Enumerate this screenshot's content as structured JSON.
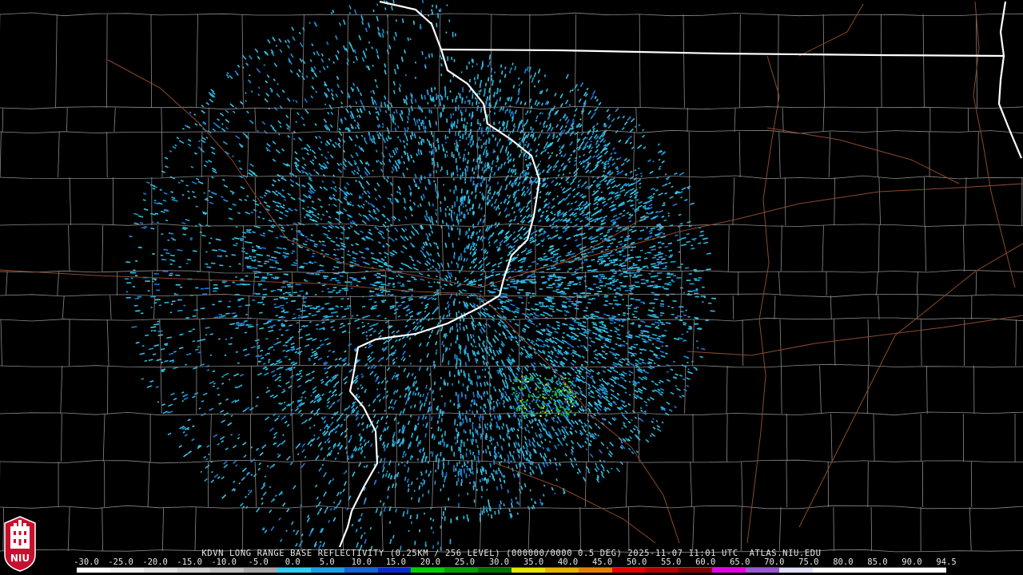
{
  "product_title": "KDVN LONG RANGE BASE REFLECTIVITY (0.25KM / 256 LEVEL) (000000/0000 0.5 DEG) 2025-11-07 11:01 UTC  ATLAS.NIU.EDU",
  "logo": {
    "text": "NIU",
    "color": "#c8102e"
  },
  "colors": {
    "background": "#000000",
    "county_lines": "#8a8a8a",
    "state_lines": "#ffffff",
    "highways": "#8b4a2b",
    "echo_primary": "#2fb8e0",
    "echo_secondary": "#1e78d8",
    "echo_green": "#22c040",
    "echo_yellow": "#e6e600"
  },
  "scale": {
    "labels": [
      "-30.0",
      "-25.0",
      "-20.0",
      "-15.0",
      "-10.0",
      "-5.0",
      "0.0",
      "5.0",
      "10.0",
      "15.0",
      "20.0",
      "25.0",
      "30.0",
      "35.0",
      "40.0",
      "45.0",
      "50.0",
      "55.0",
      "60.0",
      "65.0",
      "70.0",
      "75.0",
      "80.0",
      "85.0",
      "90.0",
      "94.5"
    ],
    "colors": [
      "#ffffff",
      "#f0f0f0",
      "#e0e0e0",
      "#d0d0d0",
      "#c0c0c0",
      "#a8a8a8",
      "#2fd0f0",
      "#1aa0e8",
      "#1464d8",
      "#0a2ad0",
      "#00d000",
      "#00a000",
      "#007000",
      "#e6e600",
      "#e6b400",
      "#e68000",
      "#e60000",
      "#b40000",
      "#800000",
      "#e600e6",
      "#9b59d0",
      "#e0e0ff",
      "#ffffff",
      "#ffffff",
      "#ffffff",
      "#ffffff"
    ]
  }
}
